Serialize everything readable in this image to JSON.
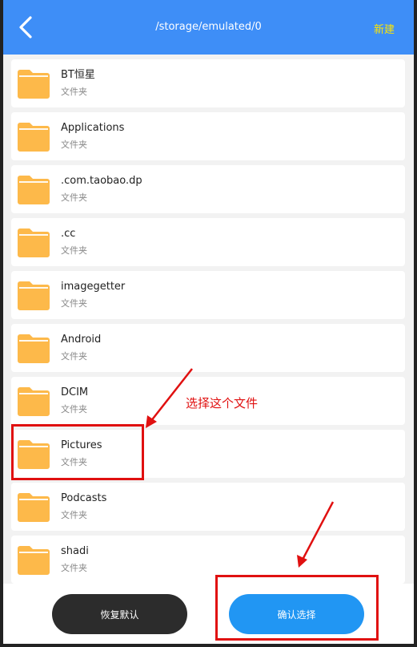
{
  "header": {
    "path": "/storage/emulated/0",
    "new_label": "新建",
    "back_icon": "chevron-left-icon"
  },
  "folders": [
    {
      "name": "BT恒星",
      "type": "文件夹"
    },
    {
      "name": "Applications",
      "type": "文件夹"
    },
    {
      "name": ".com.taobao.dp",
      "type": "文件夹"
    },
    {
      "name": ".cc",
      "type": "文件夹"
    },
    {
      "name": "imagegetter",
      "type": "文件夹"
    },
    {
      "name": "Android",
      "type": "文件夹"
    },
    {
      "name": "DCIM",
      "type": "文件夹"
    },
    {
      "name": "Pictures",
      "type": "文件夹"
    },
    {
      "name": "Podcasts",
      "type": "文件夹"
    },
    {
      "name": "shadi",
      "type": "文件夹"
    }
  ],
  "buttons": {
    "restore": "恢复默认",
    "confirm": "确认选择"
  },
  "annotation": {
    "text": "选择这个文件"
  },
  "colors": {
    "header": "#3e8ef7",
    "new_label": "#ffe600",
    "folder": "#fdb94a",
    "confirm": "#2196f3",
    "restore": "#2c2c2c",
    "annotation": "#e01010"
  }
}
